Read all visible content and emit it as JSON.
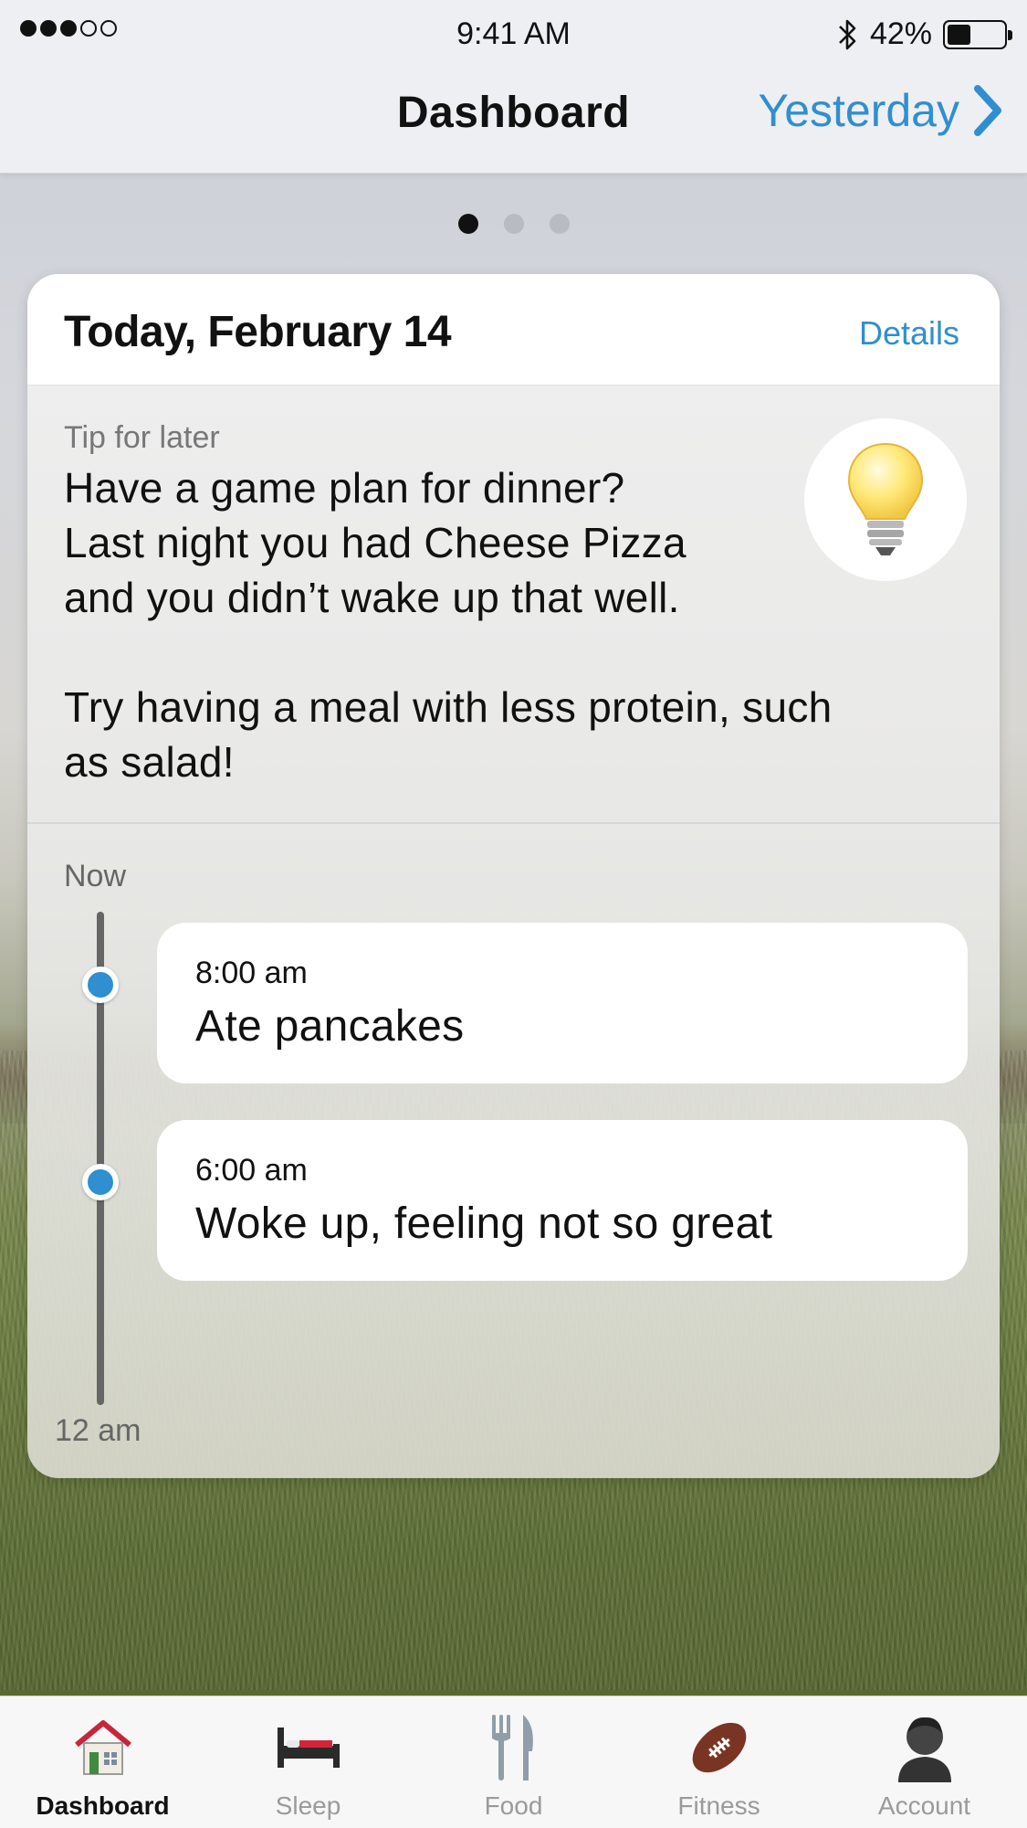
{
  "status_bar": {
    "time": "9:41 AM",
    "battery": "42%",
    "battery_level": 0.42,
    "signal_bars_filled": 3,
    "signal_bars_total": 5
  },
  "nav": {
    "title": "Dashboard",
    "right_label": "Yesterday"
  },
  "pager": {
    "count": 3,
    "active": 0
  },
  "card": {
    "title": "Today, February 14",
    "details_label": "Details",
    "tip": {
      "label": "Tip for later",
      "text": "Have a game plan for dinner?\nLast night you had Cheese Pizza\nand you didn’t wake up that well.\n\nTry having a meal with less protein, such\nas salad!"
    },
    "timeline": {
      "start_label": "Now",
      "end_label": "12 am",
      "events": [
        {
          "time": "8:00 am",
          "title": "Ate pancakes"
        },
        {
          "time": "6:00 am",
          "title": "Woke up, feeling not so great"
        }
      ]
    }
  },
  "tabs": [
    {
      "label": "Dashboard",
      "icon": "house-icon",
      "active": true
    },
    {
      "label": "Sleep",
      "icon": "bed-icon",
      "active": false
    },
    {
      "label": "Food",
      "icon": "fork-knife-icon",
      "active": false
    },
    {
      "label": "Fitness",
      "icon": "football-icon",
      "active": false
    },
    {
      "label": "Account",
      "icon": "person-icon",
      "active": false
    }
  ],
  "colors": {
    "accent": "#2f8fd0",
    "tab_inactive": "#9a9a9a",
    "tab_active": "#111111"
  }
}
